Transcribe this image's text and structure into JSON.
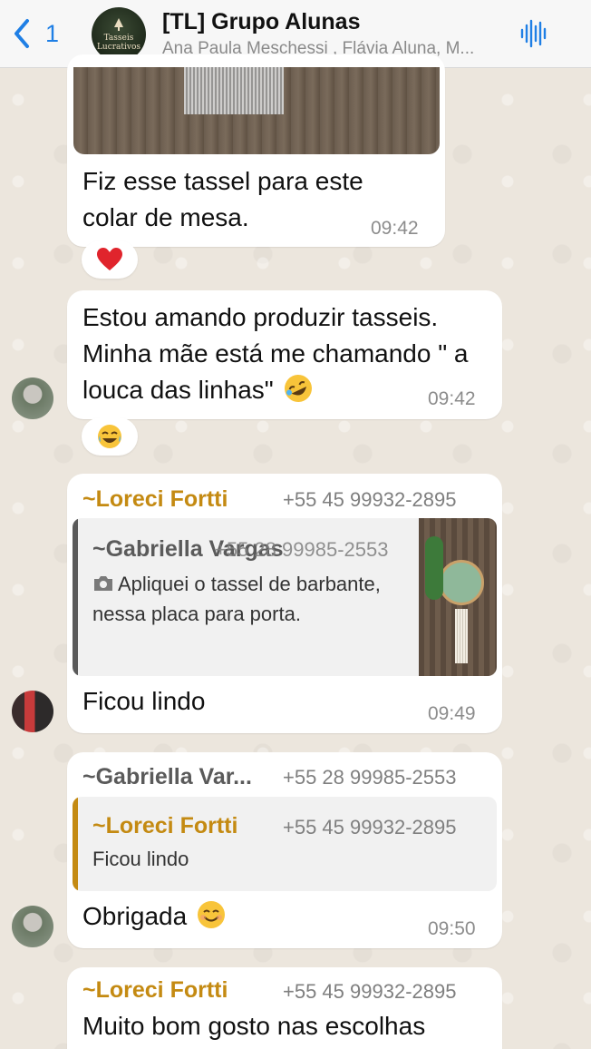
{
  "header": {
    "back_count": "1",
    "group_avatar_text": [
      "Tasseis",
      "Lucrativos"
    ],
    "title": "[TL] Grupo Alunas",
    "subtitle": "Ana Paula Meschessi , Flávia Aluna, M..."
  },
  "messages": [
    {
      "text": "Fiz esse tassel para este colar de mesa.",
      "time": "09:42",
      "reaction": "heart"
    },
    {
      "text": "Estou amando produzir tasseis. Minha mãe está me chamando \" a louca das linhas\"",
      "time": "09:42",
      "reaction": "joy"
    },
    {
      "sender": "~Loreci Fortti",
      "phone": "+55 45 99932-2895",
      "quote": {
        "sender": "~Gabriella Vargas",
        "phone": "+55 28 99985-2553",
        "text": "Apliquei o tassel de barbante, nessa placa para porta."
      },
      "text": "Ficou lindo",
      "time": "09:49"
    },
    {
      "sender": "~Gabriella Var...",
      "phone": "+55 28 99985-2553",
      "quote": {
        "sender": "~Loreci Fortti",
        "phone": "+55 45 99932-2895",
        "text": "Ficou lindo"
      },
      "text": "Obrigada",
      "time": "09:50"
    },
    {
      "sender": "~Loreci Fortti",
      "phone": "+55 45 99932-2895",
      "text": "Muito bom gosto nas escolhas"
    }
  ],
  "colors": {
    "accent": "#1f7fe5",
    "sender_gold": "#c48a12",
    "quote_bar_dark": "#5a5a5a"
  },
  "icons": [
    "chevron-left-icon",
    "audio-wave-icon",
    "camera-icon",
    "heart-emoji",
    "joy-emoji",
    "rofl-emoji",
    "smile-emoji"
  ]
}
